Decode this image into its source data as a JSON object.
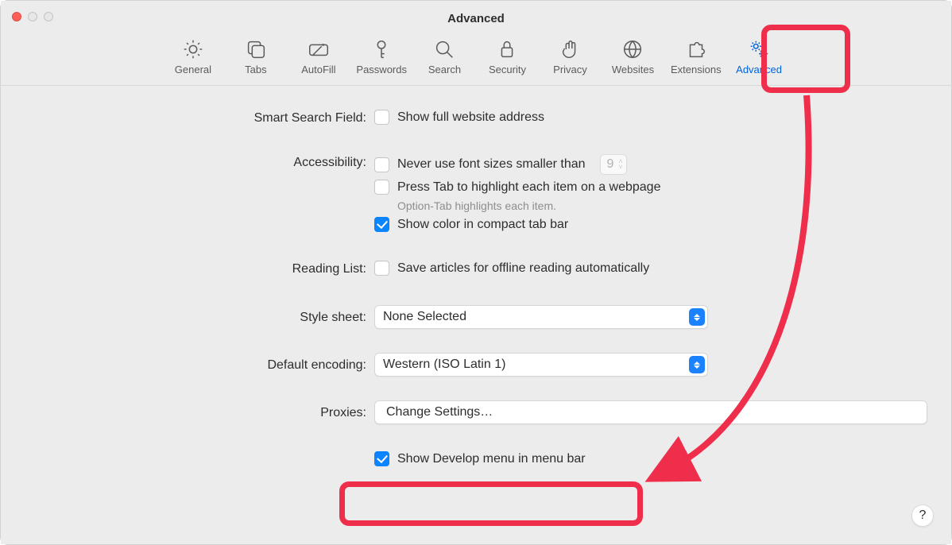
{
  "window": {
    "title": "Advanced"
  },
  "toolbar": {
    "items": [
      {
        "id": "general",
        "label": "General"
      },
      {
        "id": "tabs",
        "label": "Tabs"
      },
      {
        "id": "autofill",
        "label": "AutoFill"
      },
      {
        "id": "passwords",
        "label": "Passwords"
      },
      {
        "id": "search",
        "label": "Search"
      },
      {
        "id": "security",
        "label": "Security"
      },
      {
        "id": "privacy",
        "label": "Privacy"
      },
      {
        "id": "websites",
        "label": "Websites"
      },
      {
        "id": "extensions",
        "label": "Extensions"
      },
      {
        "id": "advanced",
        "label": "Advanced",
        "active": true
      }
    ]
  },
  "sections": {
    "smart_search": {
      "label": "Smart Search Field:",
      "full_address": {
        "label": "Show full website address",
        "checked": false
      }
    },
    "accessibility": {
      "label": "Accessibility:",
      "min_font": {
        "label": "Never use font sizes smaller than",
        "checked": false,
        "value": "9"
      },
      "tab_highlight": {
        "label": "Press Tab to highlight each item on a webpage",
        "checked": false,
        "hint": "Option-Tab highlights each item."
      },
      "color_compact": {
        "label": "Show color in compact tab bar",
        "checked": true
      }
    },
    "reading_list": {
      "label": "Reading List:",
      "offline": {
        "label": "Save articles for offline reading automatically",
        "checked": false
      }
    },
    "style_sheet": {
      "label": "Style sheet:",
      "value": "None Selected"
    },
    "encoding": {
      "label": "Default encoding:",
      "value": "Western (ISO Latin 1)"
    },
    "proxies": {
      "label": "Proxies:",
      "button": "Change Settings…"
    },
    "develop": {
      "label": "Show Develop menu in menu bar",
      "checked": true
    }
  },
  "help": "?"
}
